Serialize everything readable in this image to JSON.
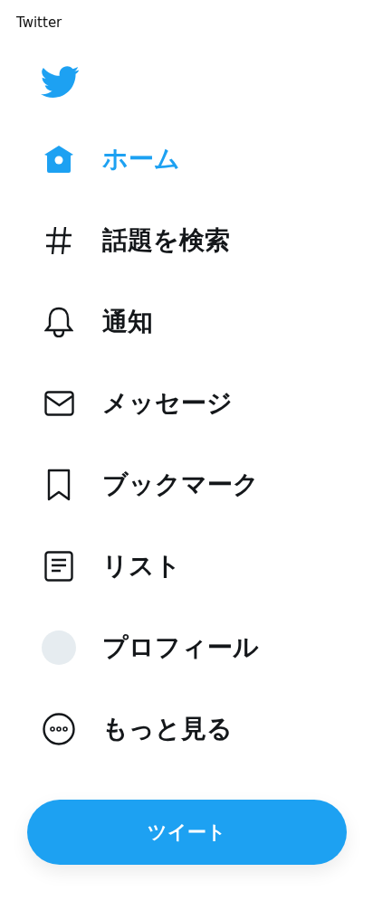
{
  "window": {
    "title": "Twitter"
  },
  "nav": [
    {
      "kind": "home",
      "label": "ホーム",
      "selected": true
    },
    {
      "kind": "hashtag",
      "label": "話題を検索",
      "selected": false
    },
    {
      "kind": "bell",
      "label": "通知",
      "selected": false
    },
    {
      "kind": "mail",
      "label": "メッセージ",
      "selected": false
    },
    {
      "kind": "bookmark",
      "label": "ブックマーク",
      "selected": false
    },
    {
      "kind": "list",
      "label": "リスト",
      "selected": false
    },
    {
      "kind": "avatar",
      "label": "プロフィール",
      "selected": false
    },
    {
      "kind": "more",
      "label": "もっと見る",
      "selected": false
    }
  ],
  "tweet_button": {
    "label": "ツイート"
  }
}
